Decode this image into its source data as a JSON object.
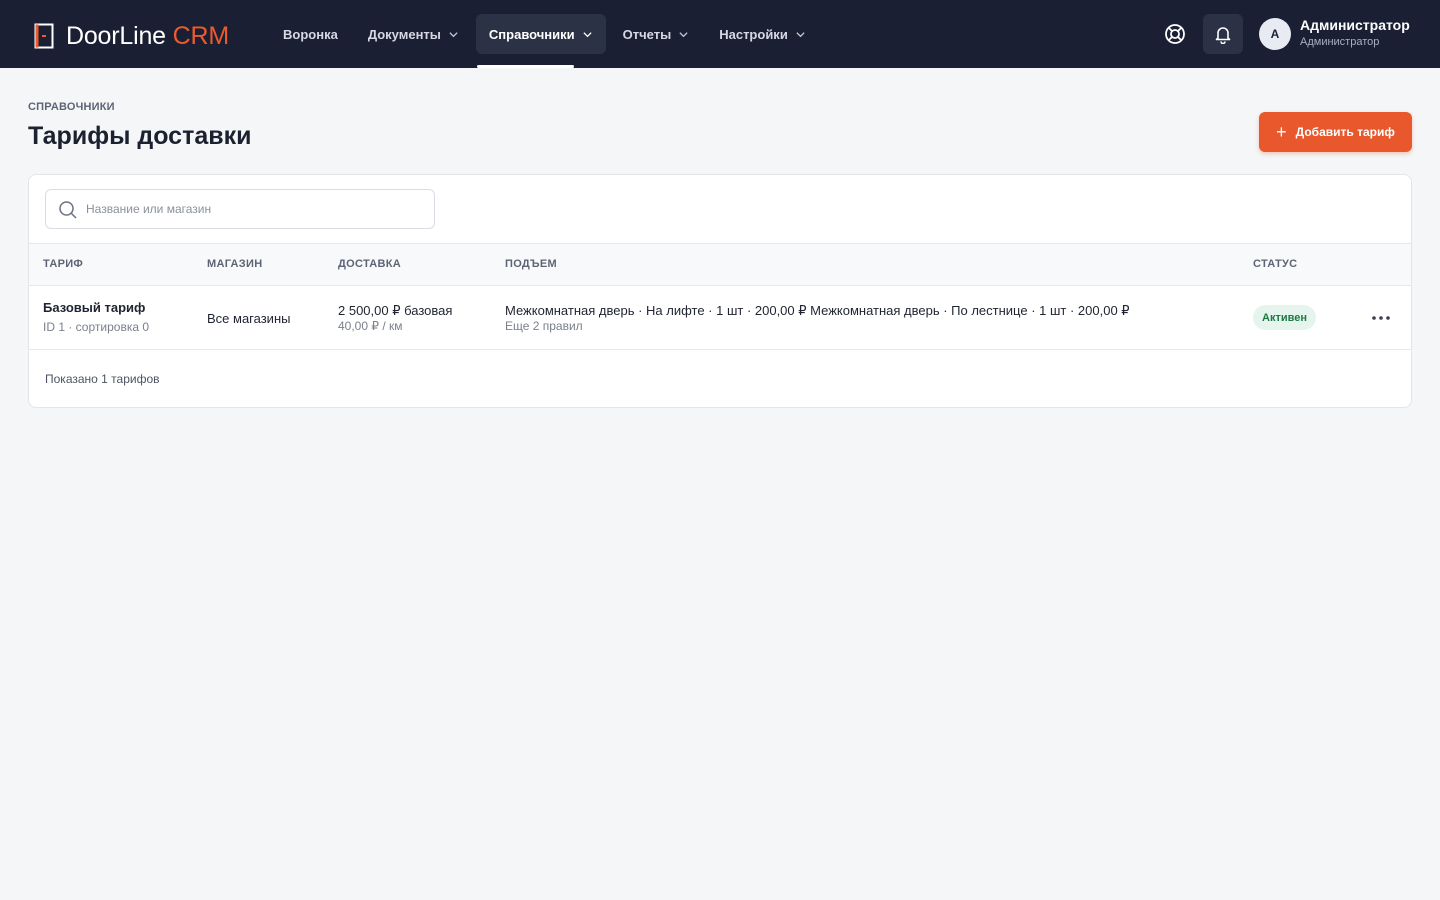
{
  "app": {
    "logo_main": "DoorLine",
    "logo_accent": "CRM"
  },
  "nav": {
    "items": [
      {
        "label": "Воронка"
      },
      {
        "label": "Документы"
      },
      {
        "label": "Справочники"
      },
      {
        "label": "Отчеты"
      },
      {
        "label": "Настройки"
      }
    ],
    "active": "Справочники"
  },
  "user": {
    "initial": "А",
    "name": "Администратор",
    "role": "Администратор"
  },
  "header": {
    "breadcrumb": "СПРАВОЧНИКИ",
    "title": "Тарифы доставки",
    "add_button": "Добавить тариф"
  },
  "search": {
    "placeholder": "Название или магазин",
    "value": ""
  },
  "table": {
    "columns": [
      "ТАРИФ",
      "МАГАЗИН",
      "ДОСТАВКА",
      "ПОДЪЕМ",
      "СТАТУС"
    ],
    "rows": [
      {
        "name": "Базовый тариф",
        "meta": "ID 1 · сортировка 0",
        "store": "Все магазины",
        "delivery_base": "2 500,00 ₽ базовая",
        "delivery_km": "40,00 ₽ / км",
        "lifting": "Межкомнатная дверь · На лифте · 1 шт · 200,00 ₽ Межкомнатная дверь · По лестнице · 1 шт · 200,00 ₽",
        "lifting_more": "Еще 2 правил",
        "status": "Активен"
      }
    ]
  },
  "footer": {
    "summary": "Показано 1 тарифов"
  },
  "colors": {
    "topbar": "#1a1f33",
    "accent": "#e8582c",
    "status_active_bg": "#e5f4ec",
    "status_active_text": "#1f7a45"
  }
}
